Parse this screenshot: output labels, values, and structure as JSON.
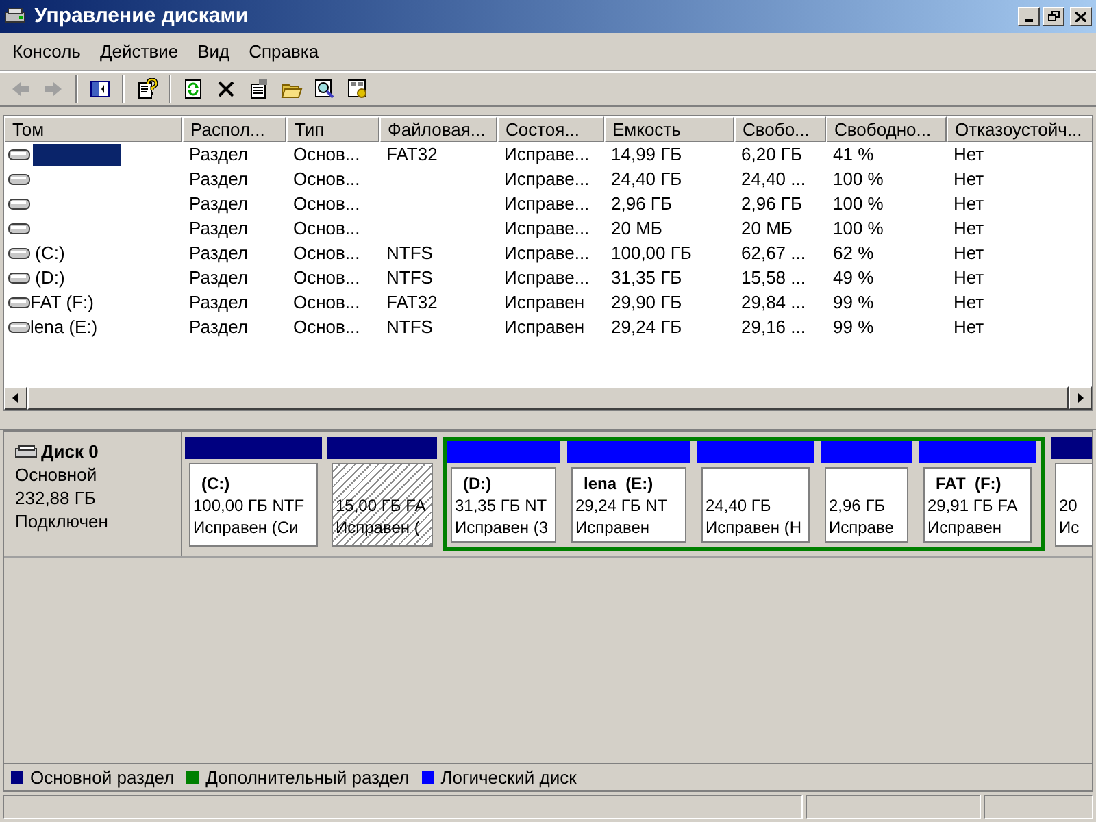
{
  "window": {
    "title": "Управление дисками"
  },
  "menu": [
    "Консоль",
    "Действие",
    "Вид",
    "Справка"
  ],
  "toolbar": [
    {
      "kind": "back",
      "disabled": true
    },
    {
      "kind": "forward",
      "disabled": true
    },
    {
      "kind": "sep"
    },
    {
      "kind": "tree"
    },
    {
      "kind": "sep"
    },
    {
      "kind": "help"
    },
    {
      "kind": "sep"
    },
    {
      "kind": "refresh"
    },
    {
      "kind": "delete"
    },
    {
      "kind": "properties"
    },
    {
      "kind": "open"
    },
    {
      "kind": "search"
    },
    {
      "kind": "settings"
    }
  ],
  "table": {
    "columns": [
      "Том",
      "Распол...",
      "Тип",
      "Файловая...",
      "Состоя...",
      "Емкость",
      "Свобо...",
      "Свободно...",
      "Отказоустойч..."
    ],
    "rows": [
      {
        "selected": true,
        "cells": [
          "",
          "Раздел",
          "Основ...",
          "FAT32",
          "Исправе...",
          "14,99 ГБ",
          "6,20 ГБ",
          "41 %",
          "Нет"
        ]
      },
      {
        "selected": false,
        "cells": [
          "",
          "Раздел",
          "Основ...",
          "",
          "Исправе...",
          "24,40 ГБ",
          "24,40 ...",
          "100 %",
          "Нет"
        ]
      },
      {
        "selected": false,
        "cells": [
          "",
          "Раздел",
          "Основ...",
          "",
          "Исправе...",
          "2,96 ГБ",
          "2,96 ГБ",
          "100 %",
          "Нет"
        ]
      },
      {
        "selected": false,
        "cells": [
          "",
          "Раздел",
          "Основ...",
          "",
          "Исправе...",
          "20 МБ",
          "20 МБ",
          "100 %",
          "Нет"
        ]
      },
      {
        "selected": false,
        "cells": [
          " (C:)",
          "Раздел",
          "Основ...",
          "NTFS",
          "Исправе...",
          "100,00 ГБ",
          "62,67 ...",
          "62 %",
          "Нет"
        ]
      },
      {
        "selected": false,
        "cells": [
          " (D:)",
          "Раздел",
          "Основ...",
          "NTFS",
          "Исправе...",
          "31,35 ГБ",
          "15,58 ...",
          "49 %",
          "Нет"
        ]
      },
      {
        "selected": false,
        "cells": [
          "FAT (F:)",
          "Раздел",
          "Основ...",
          "FAT32",
          "Исправен",
          "29,90 ГБ",
          "29,84 ...",
          "99 %",
          "Нет"
        ]
      },
      {
        "selected": false,
        "cells": [
          "lena (E:)",
          "Раздел",
          "Основ...",
          "NTFS",
          "Исправен",
          "29,24 ГБ",
          "29,16 ...",
          "99 %",
          "Нет"
        ]
      }
    ]
  },
  "disk": {
    "name": "Диск 0",
    "type": "Основной",
    "size": "232,88 ГБ",
    "state": "Подключен",
    "partitions": [
      {
        "kind": "primary",
        "selected": false,
        "label": "(C:)",
        "size": "100,00 ГБ NTF",
        "status": "Исправен (Си"
      },
      {
        "kind": "primary",
        "selected": true,
        "size": "15,00 ГБ FA",
        "status": "Исправен ("
      },
      {
        "kind": "extended",
        "children": [
          {
            "kind": "logical",
            "selected": false,
            "label": "(D:)",
            "size": "31,35 ГБ NT",
            "status": "Исправен (3"
          },
          {
            "kind": "logical",
            "selected": false,
            "label": "lena  (E:)",
            "size": "29,24 ГБ NT",
            "status": "Исправен"
          },
          {
            "kind": "logical",
            "selected": false,
            "size": "24,40 ГБ",
            "status": "Исправен (Н"
          },
          {
            "kind": "logical",
            "selected": false,
            "size": "2,96 ГБ",
            "status": "Исправе"
          },
          {
            "kind": "logical",
            "selected": false,
            "label": "FAT  (F:)",
            "size": "29,91 ГБ FA",
            "status": "Исправен"
          }
        ]
      },
      {
        "kind": "primary",
        "selected": false,
        "size": "20",
        "status": "Ис"
      }
    ]
  },
  "legend": [
    {
      "label": "Основной раздел",
      "color": "#000080"
    },
    {
      "label": "Дополнительный раздел",
      "color": "#008000"
    },
    {
      "label": "Логический диск",
      "color": "#0000ff"
    }
  ]
}
